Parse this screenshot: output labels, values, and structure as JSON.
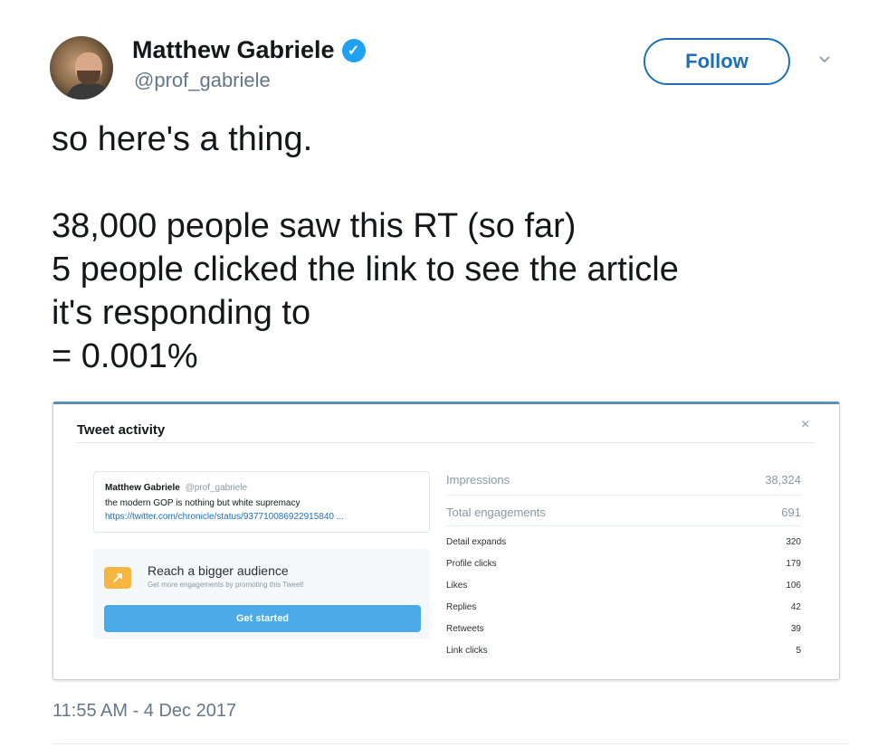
{
  "author": {
    "name": "Matthew Gabriele",
    "handle": "@prof_gabriele",
    "verified_icon": "verified-badge-icon"
  },
  "follow_label": "Follow",
  "tweet_text": "so here's a thing.\n\n38,000 people saw this RT (so far)\n5 people clicked the link to see the article\nit's responding to\n= 0.001%",
  "activity": {
    "title": "Tweet activity",
    "close_glyph": "×",
    "embedded": {
      "name": "Matthew Gabriele",
      "handle": "@prof_gabriele",
      "text": "the modern GOP is nothing but white supremacy",
      "link": "https://twitter.com/chronicle/status/937710086922915840 ..."
    },
    "promo": {
      "title": "Reach a bigger audience",
      "subtitle": "Get more engagements by promoting this Tweet!",
      "button": "Get started"
    },
    "metrics_main": [
      {
        "label": "Impressions",
        "value": "38,324"
      },
      {
        "label": "Total engagements",
        "value": "691"
      }
    ],
    "metrics_detail": [
      {
        "label": "Detail expands",
        "value": "320"
      },
      {
        "label": "Profile clicks",
        "value": "179"
      },
      {
        "label": "Likes",
        "value": "106"
      },
      {
        "label": "Replies",
        "value": "42"
      },
      {
        "label": "Retweets",
        "value": "39"
      },
      {
        "label": "Link clicks",
        "value": "5"
      }
    ]
  },
  "timestamp": "11:55 AM - 4 Dec 2017",
  "colors": {
    "accent": "#1d6fb8",
    "verified": "#1da1f2",
    "promo_button": "#4aabe8",
    "promo_icon": "#f4b63f"
  }
}
